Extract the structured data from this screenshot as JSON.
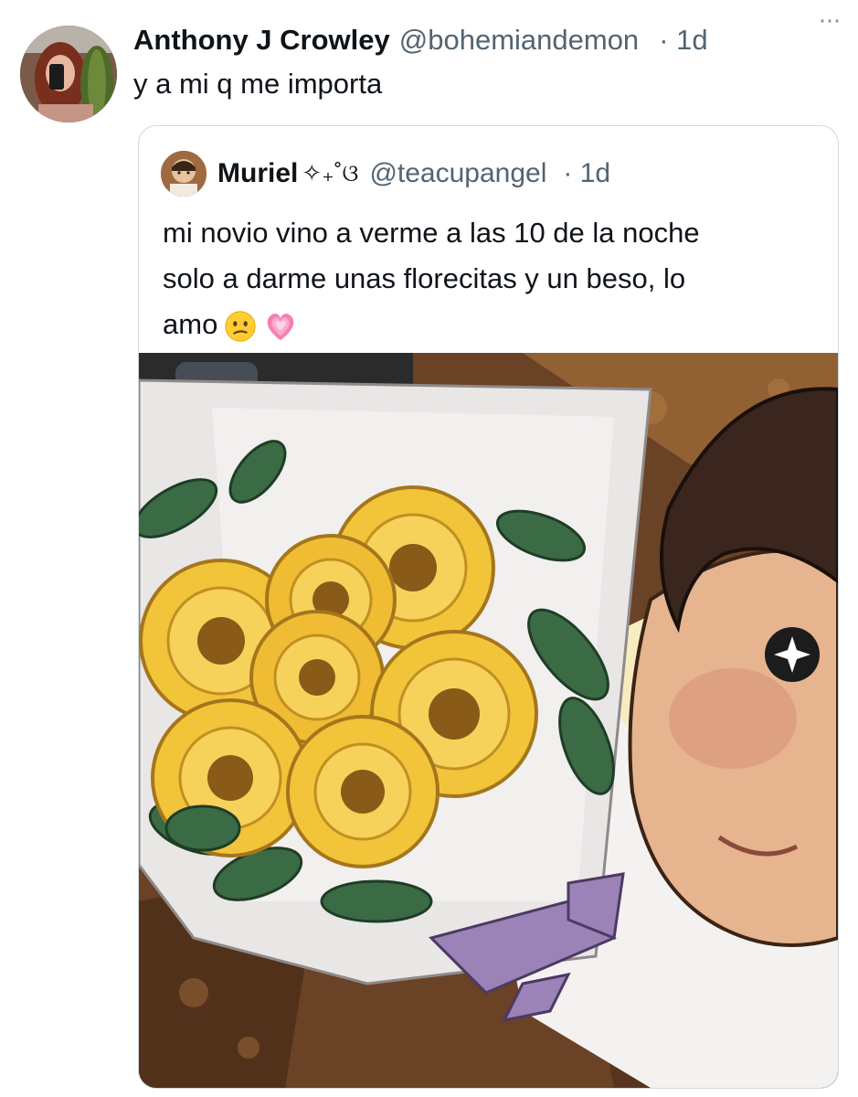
{
  "tweet": {
    "display_name": "Anthony J Crowley",
    "handle": "@bohemiandemon",
    "time": "· 1d",
    "more": "···",
    "text": "y a mi q me importa"
  },
  "quote": {
    "display_name": "Muriel",
    "name_decoration": "✧₊˚ଓ",
    "handle": "@teacupangel",
    "time": "· 1d",
    "text_lines": [
      "mi novio vino a verme a las 10 de la noche",
      "solo a darme unas florecitas y un beso, lo",
      "amo"
    ],
    "emojis": [
      "confused-face",
      "growing-heart"
    ]
  },
  "colors": {
    "text": "#0f1419",
    "secondary": "#536471",
    "border": "#cfd9de"
  }
}
